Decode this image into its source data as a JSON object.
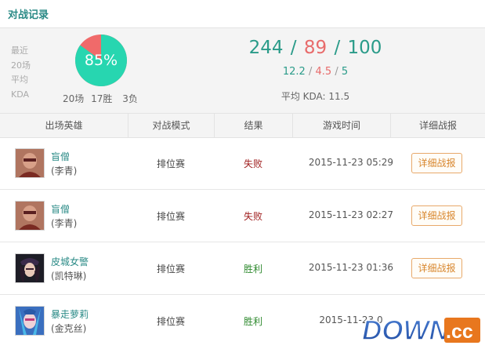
{
  "header": {
    "title": "对战记录"
  },
  "summary": {
    "recent_lines": [
      "最近",
      "20场",
      "平均",
      "KDA"
    ],
    "win_rate": "85%",
    "win_fraction": 0.85,
    "pie_colors": {
      "win": "#27d6b0",
      "loss": "#f06a6a"
    },
    "games": "20场",
    "wins": "17胜",
    "losses": "3负",
    "kda_totals": {
      "kills": "244",
      "deaths": "89",
      "assists": "100",
      "sep": "/"
    },
    "kda_avgs": {
      "kills": "12.2",
      "deaths": "4.5",
      "assists": "5",
      "sep": "/"
    },
    "avg_kda_text": "平均 KDA:  11.5"
  },
  "table": {
    "headers": [
      "出场英雄",
      "对战模式",
      "结果",
      "游戏时间",
      "详细战报"
    ],
    "rows": [
      {
        "hero": "盲僧",
        "nick": "(李青)",
        "portrait": "lee-sin-portrait",
        "mode": "排位赛",
        "result": "失败",
        "outcome": "loss",
        "time": "2015-11-23 05:29",
        "button": "详细战报"
      },
      {
        "hero": "盲僧",
        "nick": "(李青)",
        "portrait": "lee-sin-portrait",
        "mode": "排位赛",
        "result": "失败",
        "outcome": "loss",
        "time": "2015-11-23 02:27",
        "button": "详细战报"
      },
      {
        "hero": "皮城女警",
        "nick": "(凯特琳)",
        "portrait": "caitlyn-portrait",
        "mode": "排位赛",
        "result": "胜利",
        "outcome": "win",
        "time": "2015-11-23 01:36",
        "button": "详细战报"
      },
      {
        "hero": "暴走萝莉",
        "nick": "(金克丝)",
        "portrait": "jinx-portrait",
        "mode": "排位赛",
        "result": "胜利",
        "outcome": "win",
        "time": "2015-11-23 0",
        "button": ""
      }
    ]
  },
  "watermark": {
    "text": "DOWN",
    "suffix": ".cc"
  }
}
